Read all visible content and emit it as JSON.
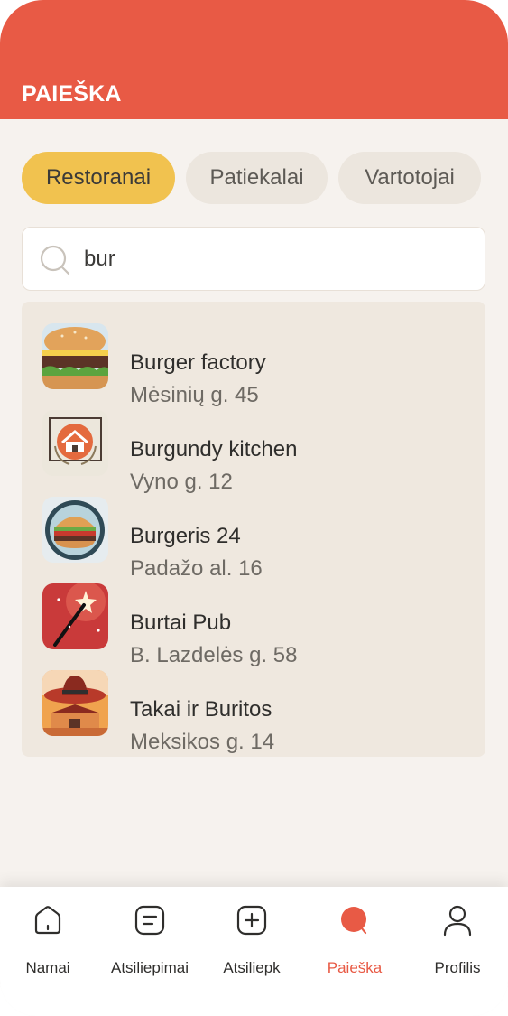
{
  "header": {
    "title": "PAIEŠKA"
  },
  "tabs": [
    {
      "label": "Restoranai",
      "active": true
    },
    {
      "label": "Patiekalai",
      "active": false
    },
    {
      "label": "Vartotojai",
      "active": false
    }
  ],
  "search": {
    "value": "bur",
    "icon": "search-icon"
  },
  "results": [
    {
      "name": "Burger factory",
      "address": "Mėsinių g. 45",
      "thumb": "burger-photo"
    },
    {
      "name": "Burgundy kitchen",
      "address": "Vyno g. 12",
      "thumb": "house-logo"
    },
    {
      "name": "Burgeris 24",
      "address": "Padažo al. 16",
      "thumb": "burger-logo"
    },
    {
      "name": "Burtai Pub",
      "address": "B. Lazdelės g. 58",
      "thumb": "magic-wand"
    },
    {
      "name": "Takai ir Buritos",
      "address": "Meksikos g. 14",
      "thumb": "sombrero"
    }
  ],
  "nav": [
    {
      "label": "Namai",
      "icon": "home-icon",
      "active": false
    },
    {
      "label": "Atsiliepimai",
      "icon": "reviews-icon",
      "active": false
    },
    {
      "label": "Atsiliepk",
      "icon": "add-review-icon",
      "active": false
    },
    {
      "label": "Paieška",
      "icon": "search-icon",
      "active": true
    },
    {
      "label": "Profilis",
      "icon": "profile-icon",
      "active": false
    }
  ],
  "colors": {
    "accent": "#e85a45",
    "tab_active": "#f1c24f",
    "background": "#f6f2ee"
  }
}
